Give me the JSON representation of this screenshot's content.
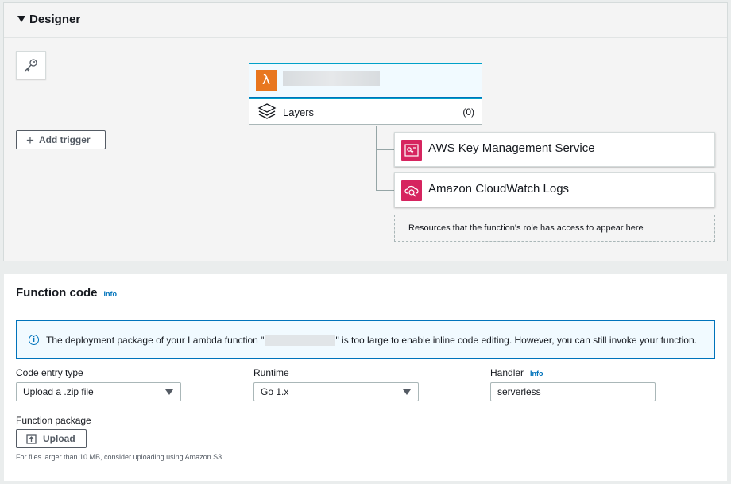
{
  "designer": {
    "title": "Designer",
    "add_trigger_label": "Add trigger",
    "function": {
      "layers_label": "Layers",
      "layers_count": "(0)"
    },
    "resources": [
      {
        "label": "AWS Key Management Service",
        "icon": "kms-icon"
      },
      {
        "label": "Amazon CloudWatch Logs",
        "icon": "cloudwatch-logs-icon"
      }
    ],
    "resources_placeholder": "Resources that the function's role has access to appear here"
  },
  "function_code": {
    "title": "Function code",
    "info_link": "Info",
    "alert": {
      "text_before": "The deployment package of your Lambda function \"",
      "text_after": "\" is too large to enable inline code editing. However, you can still invoke your function."
    },
    "code_entry_type": {
      "label": "Code entry type",
      "value": "Upload a .zip file"
    },
    "runtime": {
      "label": "Runtime",
      "value": "Go 1.x"
    },
    "handler": {
      "label": "Handler",
      "info_link": "Info",
      "value": "serverless"
    },
    "function_package": {
      "label": "Function package",
      "upload_label": "Upload",
      "hint": "For files larger than 10 MB, consider uploading using Amazon S3."
    }
  },
  "colors": {
    "lambda_orange": "#e8771f",
    "resource_pink": "#d6245f",
    "link_blue": "#0073bb"
  }
}
